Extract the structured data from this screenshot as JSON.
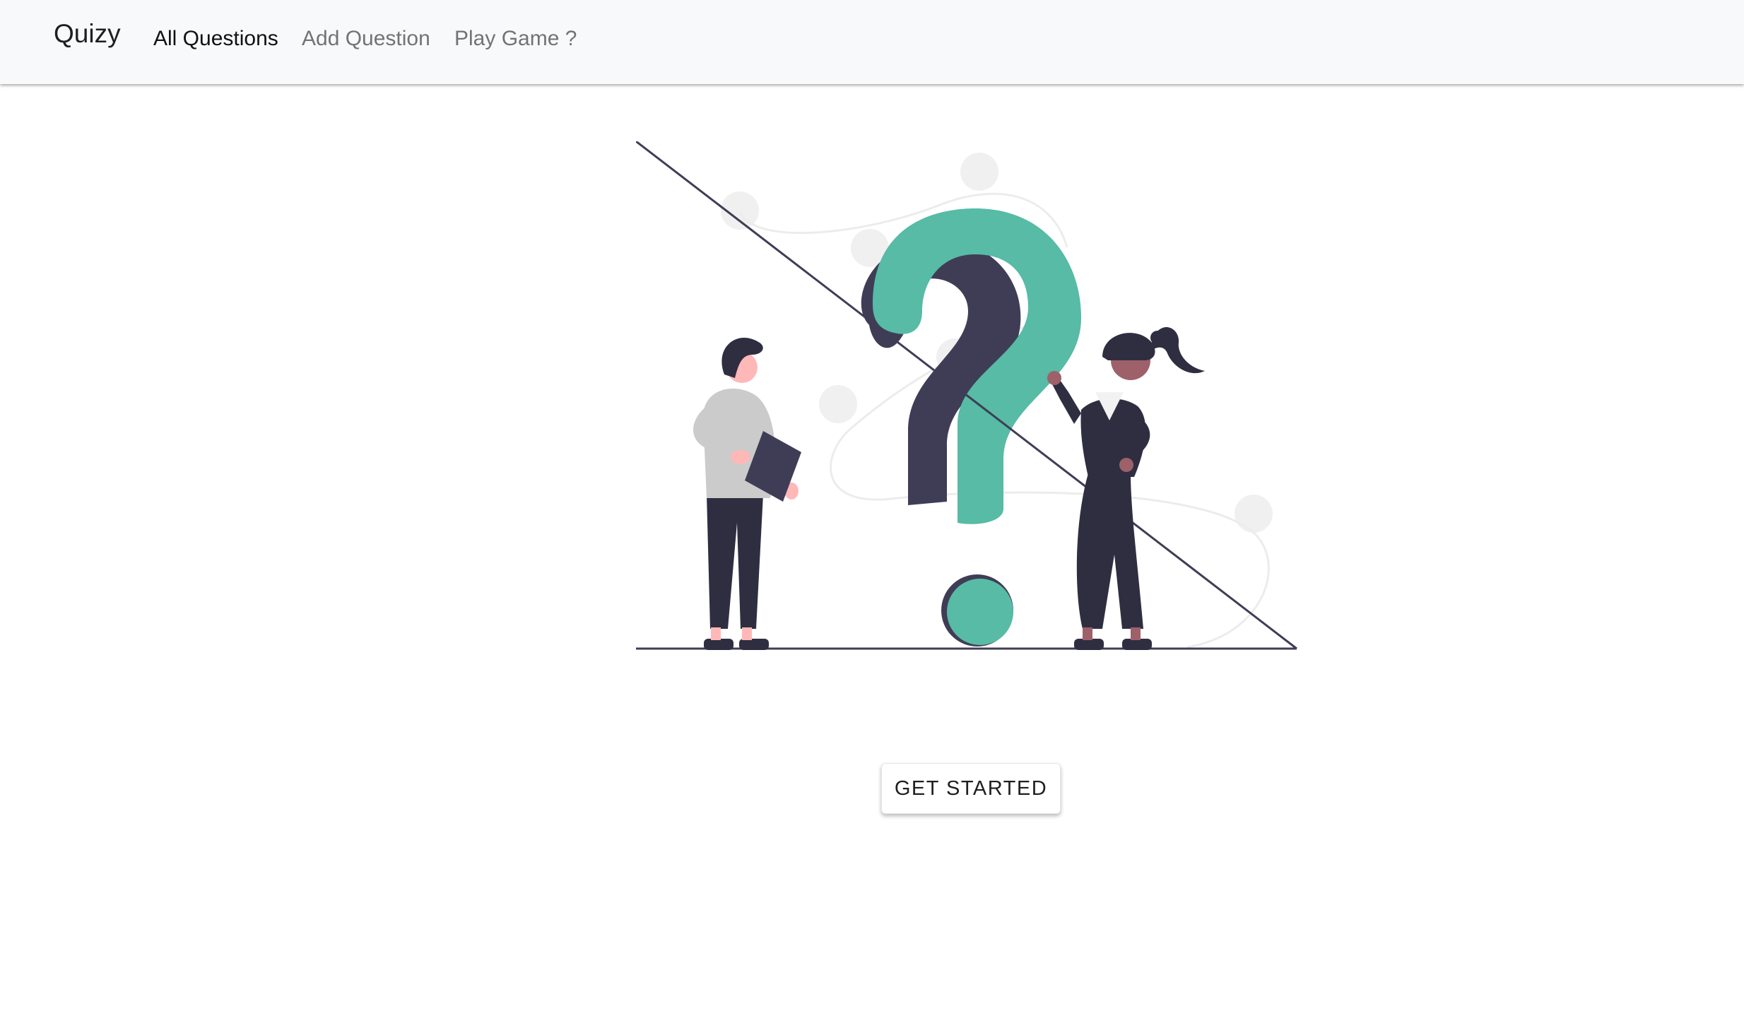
{
  "app": {
    "brand": "Quizy"
  },
  "nav": {
    "items": [
      {
        "label": "All Questions",
        "active": true
      },
      {
        "label": "Add Question",
        "active": false
      },
      {
        "label": "Play Game ?",
        "active": false
      }
    ]
  },
  "hero": {
    "illustration": "question-mark-people-illustration",
    "cta_label": "GET STARTED"
  },
  "colors": {
    "accent": "#57bba6",
    "dark": "#2f2e41",
    "navbar_bg": "#f8f9fa"
  }
}
